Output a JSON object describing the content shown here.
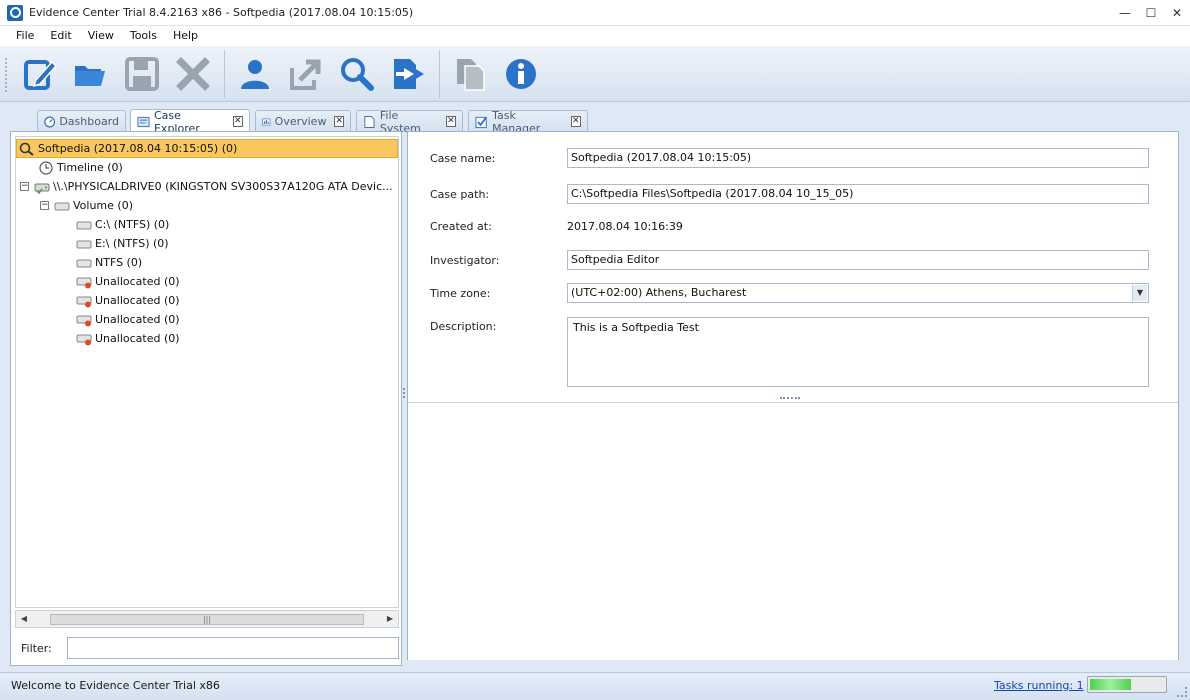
{
  "window": {
    "title": "Evidence Center Trial 8.4.2163 x86 - Softpedia (2017.08.04 10:15:05)",
    "minimize": "—",
    "maximize": "☐",
    "close": "✕"
  },
  "menu": [
    "File",
    "Edit",
    "View",
    "Tools",
    "Help"
  ],
  "toolbar": {
    "buttons": [
      "new-case-icon",
      "open-folder-icon",
      "save-icon",
      "delete-icon",
      "investigator-icon",
      "export-icon",
      "search-icon",
      "add-evidence-icon",
      "copy-icon",
      "info-icon"
    ]
  },
  "tabs": [
    {
      "label": "Dashboard",
      "icon": "dashboard-icon"
    },
    {
      "label": "Case Explorer",
      "icon": "case-explorer-icon",
      "active": true
    },
    {
      "label": "Overview",
      "icon": "overview-icon"
    },
    {
      "label": "File System",
      "icon": "file-system-icon"
    },
    {
      "label": "Task Manager",
      "icon": "task-manager-icon"
    }
  ],
  "tree": {
    "root": "Softpedia (2017.08.04 10:15:05) (0)",
    "timeline": "Timeline (0)",
    "drive": "\\\\.\\PHYSICALDRIVE0 (KINGSTON SV300S37A120G ATA Devic...",
    "volume": "Volume (0)",
    "items": [
      {
        "label": "C:\\ (NTFS) (0)",
        "type": "disk"
      },
      {
        "label": "E:\\ (NTFS) (0)",
        "type": "disk"
      },
      {
        "label": "NTFS (0)",
        "type": "disk"
      },
      {
        "label": "Unallocated (0)",
        "type": "unallocated"
      },
      {
        "label": "Unallocated (0)",
        "type": "unallocated"
      },
      {
        "label": "Unallocated (0)",
        "type": "unallocated"
      },
      {
        "label": "Unallocated (0)",
        "type": "unallocated"
      }
    ],
    "expand_minus": "−"
  },
  "scroll": {
    "left": "◀",
    "right": "▶",
    "thumb": "|||"
  },
  "filter": {
    "label": "Filter:",
    "value": ""
  },
  "case_form": {
    "name_label": "Case name:",
    "name_value": "Softpedia (2017.08.04 10:15:05)",
    "path_label": "Case path:",
    "path_value": "C:\\Softpedia Files\\Softpedia (2017.08.04 10_15_05)",
    "created_label": "Created at:",
    "created_value": "2017.08.04 10:16:39",
    "investigator_label": "Investigator:",
    "investigator_value": "Softpedia Editor",
    "timezone_label": "Time zone:",
    "timezone_value": "(UTC+02:00) Athens, Bucharest",
    "description_label": "Description:",
    "description_value": "This is a Softpedia Test",
    "dropdown_arrow": "▼"
  },
  "status": {
    "text": "Welcome to Evidence Center Trial x86",
    "tasks": "Tasks running: 1",
    "progress_fraction": 0.55
  },
  "colors": {
    "selection": "#f9c75e",
    "accent_blue": "#1f67b5",
    "link": "#1446b3"
  }
}
